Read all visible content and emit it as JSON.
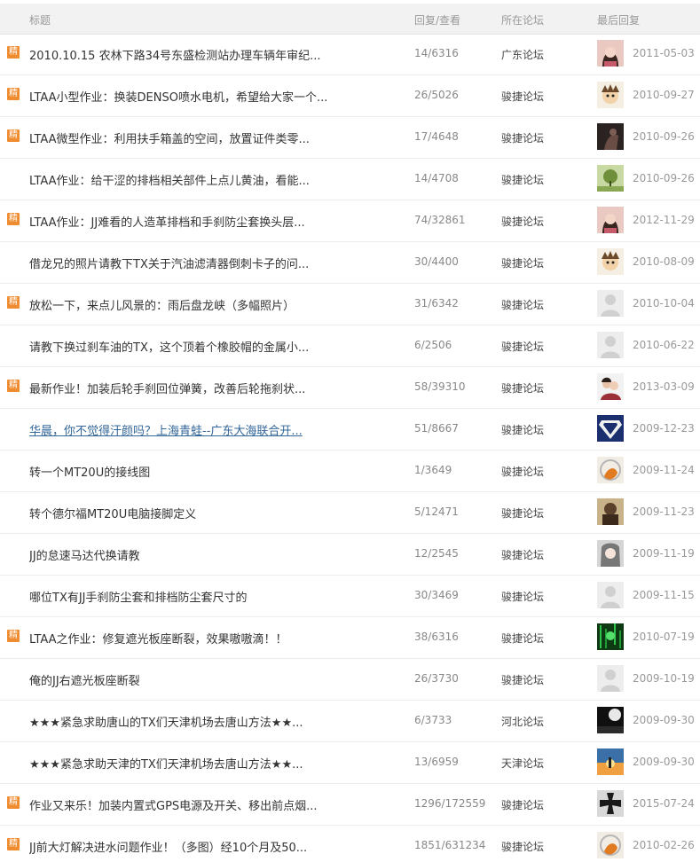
{
  "header": {
    "title": "标题",
    "stats": "回复/查看",
    "forum": "所在论坛",
    "last_reply": "最后回复"
  },
  "badge_label": "精",
  "colors": {
    "badge": "#f08c30",
    "link": "#336699"
  },
  "threads": [
    {
      "featured": true,
      "title": "2010.10.15 农林下路34号东盛检测站办理车辆年审纪...",
      "stats": "14/6316",
      "forum": "广东论坛",
      "avatar": "portrait",
      "date": "2011-05-03"
    },
    {
      "featured": true,
      "title": "LTAA小型作业：换装DENSO喷水电机，希望给大家一个...",
      "stats": "26/5026",
      "forum": "骏捷论坛",
      "avatar": "cartoon",
      "date": "2010-09-27"
    },
    {
      "featured": true,
      "title": "LTAA微型作业：利用扶手箱盖的空间，放置证件类零...",
      "stats": "17/4648",
      "forum": "骏捷论坛",
      "avatar": "dark",
      "date": "2010-09-26"
    },
    {
      "featured": false,
      "title": "LTAA作业：给干涩的排档相关部件上点儿黄油，看能...",
      "stats": "14/4708",
      "forum": "骏捷论坛",
      "avatar": "green",
      "date": "2010-09-26"
    },
    {
      "featured": true,
      "title": "LTAA作业：JJ难看的人造革排档和手刹防尘套换头层...",
      "stats": "74/32861",
      "forum": "骏捷论坛",
      "avatar": "portrait",
      "date": "2012-11-29"
    },
    {
      "featured": false,
      "title": "借龙兄的照片请教下TX关于汽油滤清器倒刺卡子的问...",
      "stats": "30/4400",
      "forum": "骏捷论坛",
      "avatar": "cartoon",
      "date": "2010-08-09"
    },
    {
      "featured": true,
      "title": "放松一下，来点儿风景的：雨后盘龙峡（多幅照片）",
      "stats": "31/6342",
      "forum": "骏捷论坛",
      "avatar": "default",
      "date": "2010-10-04"
    },
    {
      "featured": false,
      "title": "请教下换过刹车油的TX，这个顶着个橡胶帽的金属小...",
      "stats": "6/2506",
      "forum": "骏捷论坛",
      "avatar": "default",
      "date": "2010-06-22"
    },
    {
      "featured": true,
      "title": "最新作业！加装后轮手刹回位弹簧，改善后轮拖刹状...",
      "stats": "58/39310",
      "forum": "骏捷论坛",
      "avatar": "couple",
      "date": "2013-03-09"
    },
    {
      "featured": false,
      "link": true,
      "title": "华晨，你不觉得汗颜吗？上海青蛙--广东大海联合开...",
      "stats": "51/8667",
      "forum": "骏捷论坛",
      "avatar": "superman",
      "date": "2009-12-23"
    },
    {
      "featured": false,
      "title": "转一个MT20U的接线图",
      "stats": "1/3649",
      "forum": "骏捷论坛",
      "avatar": "orange",
      "date": "2009-11-24"
    },
    {
      "featured": false,
      "title": "转个德尔福MT20U电脑接脚定义",
      "stats": "5/12471",
      "forum": "骏捷论坛",
      "avatar": "brown",
      "date": "2009-11-23"
    },
    {
      "featured": false,
      "title": "JJ的怠速马达代换请教",
      "stats": "12/2545",
      "forum": "骏捷论坛",
      "avatar": "anime",
      "date": "2009-11-19"
    },
    {
      "featured": false,
      "title": "哪位TX有JJ手刹防尘套和排档防尘套尺寸的",
      "stats": "30/3469",
      "forum": "骏捷论坛",
      "avatar": "default",
      "date": "2009-11-15"
    },
    {
      "featured": true,
      "title": "LTAA之作业：修复遮光板座断裂，效果嗷嗷滴！！",
      "stats": "38/6316",
      "forum": "骏捷论坛",
      "avatar": "matrix",
      "date": "2010-07-19"
    },
    {
      "featured": false,
      "title": "俺的JJ右遮光板座断裂",
      "stats": "26/3730",
      "forum": "骏捷论坛",
      "avatar": "default",
      "date": "2009-10-19"
    },
    {
      "featured": false,
      "title": "★★★紧急求助唐山的TX们天津机场去唐山方法★★...",
      "stats": "6/3733",
      "forum": "河北论坛",
      "avatar": "night",
      "date": "2009-09-30"
    },
    {
      "featured": false,
      "title": "★★★紧急求助天津的TX们天津机场去唐山方法★★...",
      "stats": "13/6959",
      "forum": "天津论坛",
      "avatar": "sunset",
      "date": "2009-09-30"
    },
    {
      "featured": true,
      "title": "作业又来乐！加装内置式GPS电源及开关、移出前点烟...",
      "stats": "1296/172559",
      "forum": "骏捷论坛",
      "avatar": "cross",
      "date": "2015-07-24"
    },
    {
      "featured": true,
      "title": "JJ前大灯解决进水问题作业！（多图）经10个月及50...",
      "stats": "1851/631234",
      "forum": "骏捷论坛",
      "avatar": "orange",
      "date": "2010-02-26"
    }
  ]
}
